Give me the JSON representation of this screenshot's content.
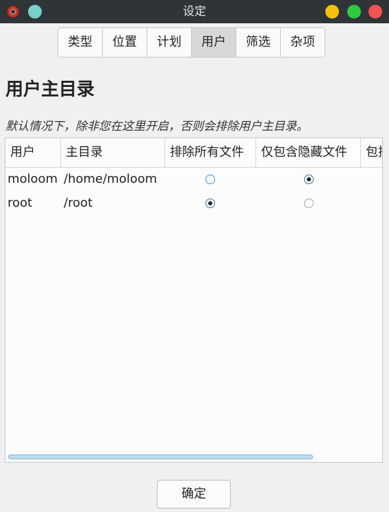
{
  "window": {
    "title": "设定"
  },
  "tabs": [
    {
      "label": "类型"
    },
    {
      "label": "位置"
    },
    {
      "label": "计划"
    },
    {
      "label": "用户",
      "active": true
    },
    {
      "label": "筛选"
    },
    {
      "label": "杂项"
    }
  ],
  "section": {
    "title": "用户主目录",
    "description": "默认情况下，除非您在这里开启，否则会排除用户主目录。"
  },
  "table": {
    "columns": [
      "用户",
      "主目录",
      "排除所有文件",
      "仅包含隐藏文件",
      "包括"
    ],
    "rows": [
      {
        "user": "moloom",
        "home": "/home/moloom",
        "selected": "仅包含隐藏文件"
      },
      {
        "user": "root",
        "home": "/root",
        "selected": "排除所有文件"
      }
    ]
  },
  "footer": {
    "ok_label": "确定"
  }
}
